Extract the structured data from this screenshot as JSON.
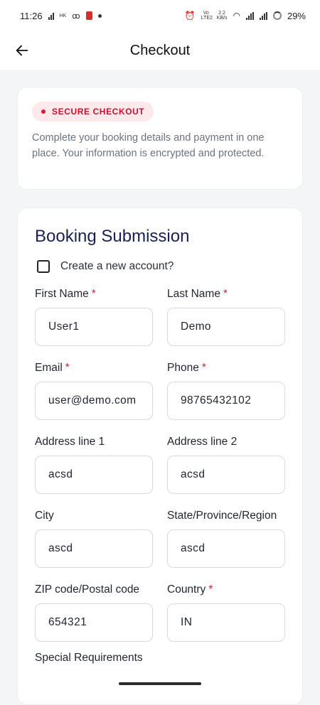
{
  "status_bar": {
    "time": "11:26",
    "hk": "HK",
    "volte": "Vo LTE2",
    "speed_value": "2.2",
    "speed_unit": "KB/s",
    "battery": "29%"
  },
  "app_bar": {
    "title": "Checkout",
    "back_icon": "arrow-left-icon"
  },
  "secure_card": {
    "badge": "SECURE CHECKOUT",
    "description": "Complete your booking details and payment in one place. Your information is encrypted and protected."
  },
  "form": {
    "title": "Booking Submission",
    "create_account_label": "Create a new account?",
    "create_account_checked": false,
    "required_marker": "*",
    "fields": [
      {
        "label": "First Name",
        "required": true,
        "value": "User1"
      },
      {
        "label": "Last Name",
        "required": true,
        "value": "Demo"
      },
      {
        "label": "Email",
        "required": true,
        "value": "user@demo.com"
      },
      {
        "label": "Phone",
        "required": true,
        "value": "98765432102"
      },
      {
        "label": "Address line 1",
        "required": false,
        "value": "acsd"
      },
      {
        "label": "Address line 2",
        "required": false,
        "value": "acsd"
      },
      {
        "label": "City",
        "required": false,
        "value": "ascd"
      },
      {
        "label": "State/Province/Region",
        "required": false,
        "value": "ascd"
      },
      {
        "label": "ZIP code/Postal code",
        "required": false,
        "value": "654321"
      },
      {
        "label": "Country",
        "required": true,
        "value": "IN"
      }
    ],
    "special_requirements_label": "Special Requirements"
  },
  "colors": {
    "accent_red": "#d81b3c",
    "title_navy": "#1a2150"
  }
}
